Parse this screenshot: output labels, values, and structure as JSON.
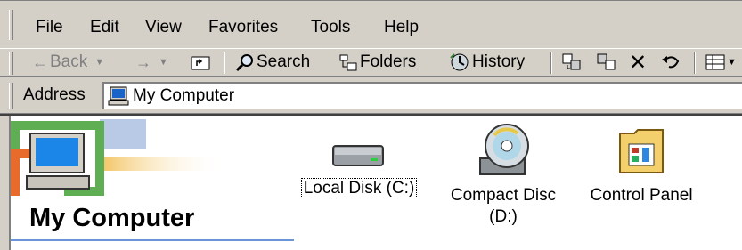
{
  "menu": {
    "file": "File",
    "edit": "Edit",
    "view": "View",
    "favorites": "Favorites",
    "tools": "Tools",
    "help": "Help"
  },
  "toolbar": {
    "back": "Back",
    "search": "Search",
    "folders": "Folders",
    "history": "History"
  },
  "address": {
    "label": "Address",
    "value": "My Computer"
  },
  "panel": {
    "title": "My Computer"
  },
  "items": [
    {
      "label": "Local Disk (C:)",
      "icon": "hard-disk-icon"
    },
    {
      "label_line1": "Compact Disc",
      "label_line2": "(D:)",
      "icon": "compact-disc-icon"
    },
    {
      "label": "Control Panel",
      "icon": "control-panel-icon"
    }
  ],
  "colors": {
    "chrome": "#d4d0c8",
    "accent_line": "#6a95d6"
  }
}
